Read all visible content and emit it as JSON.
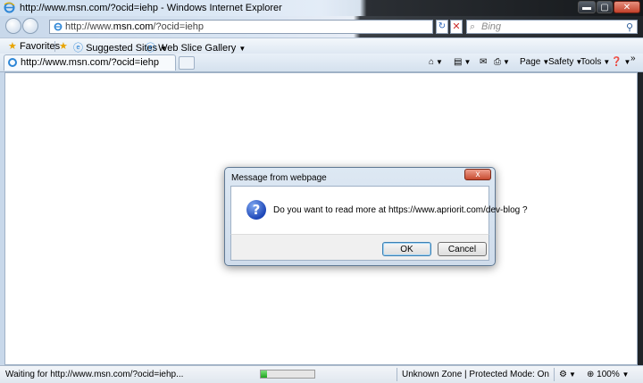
{
  "window": {
    "title": "http://www.msn.com/?ocid=iehp - Windows Internet Explorer",
    "min_glyph": "▬",
    "max_glyph": "▢",
    "close_glyph": "✕"
  },
  "nav": {
    "address": "http://www.msn.com/?ocid=iehp",
    "address_prefix": "http://www.",
    "address_host": "msn.com",
    "address_suffix": "/?ocid=iehp",
    "search_placeholder": "Bing"
  },
  "favorites": {
    "favorites_label": "Favorites",
    "suggested_sites": "Suggested Sites",
    "web_slice_gallery": "Web Slice Gallery"
  },
  "tab": {
    "title": "http://www.msn.com/?ocid=iehp"
  },
  "commands": {
    "page": "Page",
    "safety": "Safety",
    "tools": "Tools",
    "chevron": "»"
  },
  "status": {
    "text": "Waiting for http://www.msn.com/?ocid=iehp...",
    "progress": 0.12,
    "zone": "Unknown Zone | Protected Mode: On",
    "zoom": "100%"
  },
  "dialog": {
    "title": "Message from webpage",
    "message": "Do you want to read more at https://www.apriorit.com/dev-blog ?",
    "icon_glyph": "?",
    "ok_label": "OK",
    "cancel_label": "Cancel",
    "close_glyph": "x"
  },
  "colors": {
    "accent": "#2d86d6",
    "progress": "#1fa51f",
    "close_red": "#c74a30"
  }
}
